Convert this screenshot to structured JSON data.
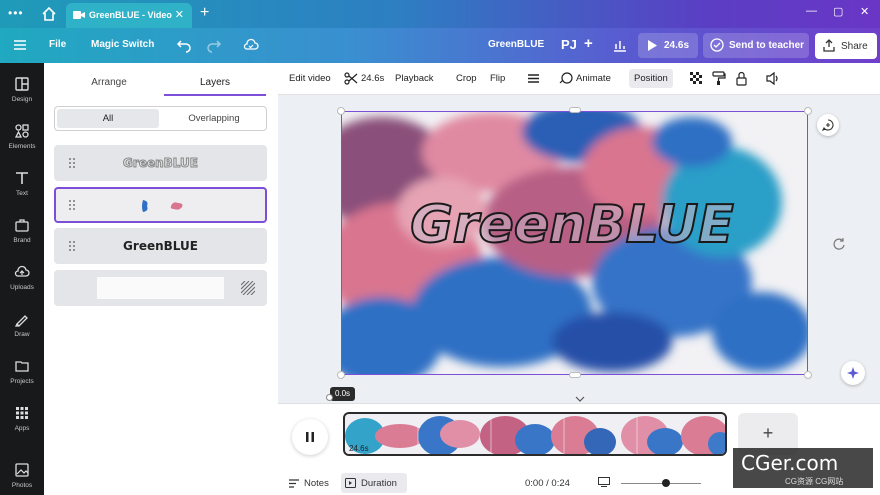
{
  "browser": {
    "tab_title": "GreenBLUE - Video",
    "new_tab_symbol": "+"
  },
  "header": {
    "file_label": "File",
    "magic_switch_label": "Magic Switch",
    "doc_title": "GreenBLUE",
    "avatar_initials": "PJ",
    "add_symbol": "+",
    "duration_label": "24.6s",
    "send_to_teacher_label": "Send to teacher",
    "share_label": "Share"
  },
  "rail": {
    "items": [
      {
        "label": "Design",
        "icon": "design-icon"
      },
      {
        "label": "Elements",
        "icon": "elements-icon"
      },
      {
        "label": "Text",
        "icon": "text-icon"
      },
      {
        "label": "Brand",
        "icon": "brand-icon"
      },
      {
        "label": "Uploads",
        "icon": "uploads-icon"
      },
      {
        "label": "Draw",
        "icon": "draw-icon"
      },
      {
        "label": "Projects",
        "icon": "projects-icon"
      },
      {
        "label": "Apps",
        "icon": "apps-icon"
      },
      {
        "label": "Photos",
        "icon": "photos-icon"
      }
    ]
  },
  "panel": {
    "tabs": [
      "Arrange",
      "Layers"
    ],
    "active_tab": "Layers",
    "filters": [
      "All",
      "Overlapping"
    ],
    "active_filter": "All",
    "layers": [
      {
        "text": "GreenBLUE",
        "style": "outline"
      },
      {
        "text": "",
        "style": "shapes",
        "selected": true
      },
      {
        "text": "GreenBLUE",
        "style": "solid"
      },
      {
        "text": "",
        "style": "background"
      }
    ]
  },
  "toolbar": {
    "edit_video": "Edit video",
    "trim_duration": "24.6s",
    "playback": "Playback",
    "crop": "Crop",
    "flip": "Flip",
    "animate": "Animate",
    "position": "Position"
  },
  "canvas": {
    "title_text": "GreenBLUE",
    "colors": {
      "pink": "#d9758f",
      "blue": "#2f6fc4",
      "cyan": "#2a9fc8",
      "text_fill": "#c9b6c9"
    }
  },
  "timeline": {
    "current_time_bubble": "0.0s",
    "clip_duration": "24.6s",
    "add_symbol": "+"
  },
  "footer": {
    "notes_label": "Notes",
    "duration_label": "Duration",
    "time_readout": "0:00 / 0:24"
  },
  "watermark": {
    "brand": "CGer.com",
    "sub": "CG资源 CG网站"
  }
}
